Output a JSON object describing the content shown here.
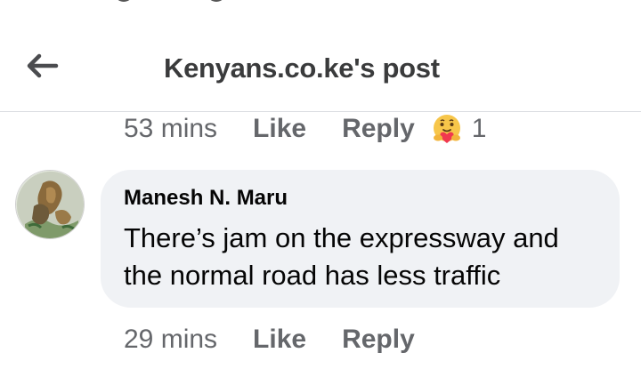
{
  "header": {
    "title": "Kenyans.co.ke's post",
    "back_icon": "arrow-left-icon"
  },
  "previous_comment_actions": {
    "time": "53 mins",
    "like_label": "Like",
    "reply_label": "Reply",
    "reaction_icon": "care-reaction-icon",
    "reaction_count": "1"
  },
  "comment": {
    "author": "Manesh N. Maru",
    "text": "There’s jam on the expressway and the normal road has less traffic",
    "avatar_icon": "avatar"
  },
  "comment_actions": {
    "time": "29 mins",
    "like_label": "Like",
    "reply_label": "Reply"
  },
  "colors": {
    "bubble": "#f0f2f5",
    "secondary_text": "#65676b",
    "title_text": "#3a3b3c",
    "divider": "#dadde1"
  }
}
